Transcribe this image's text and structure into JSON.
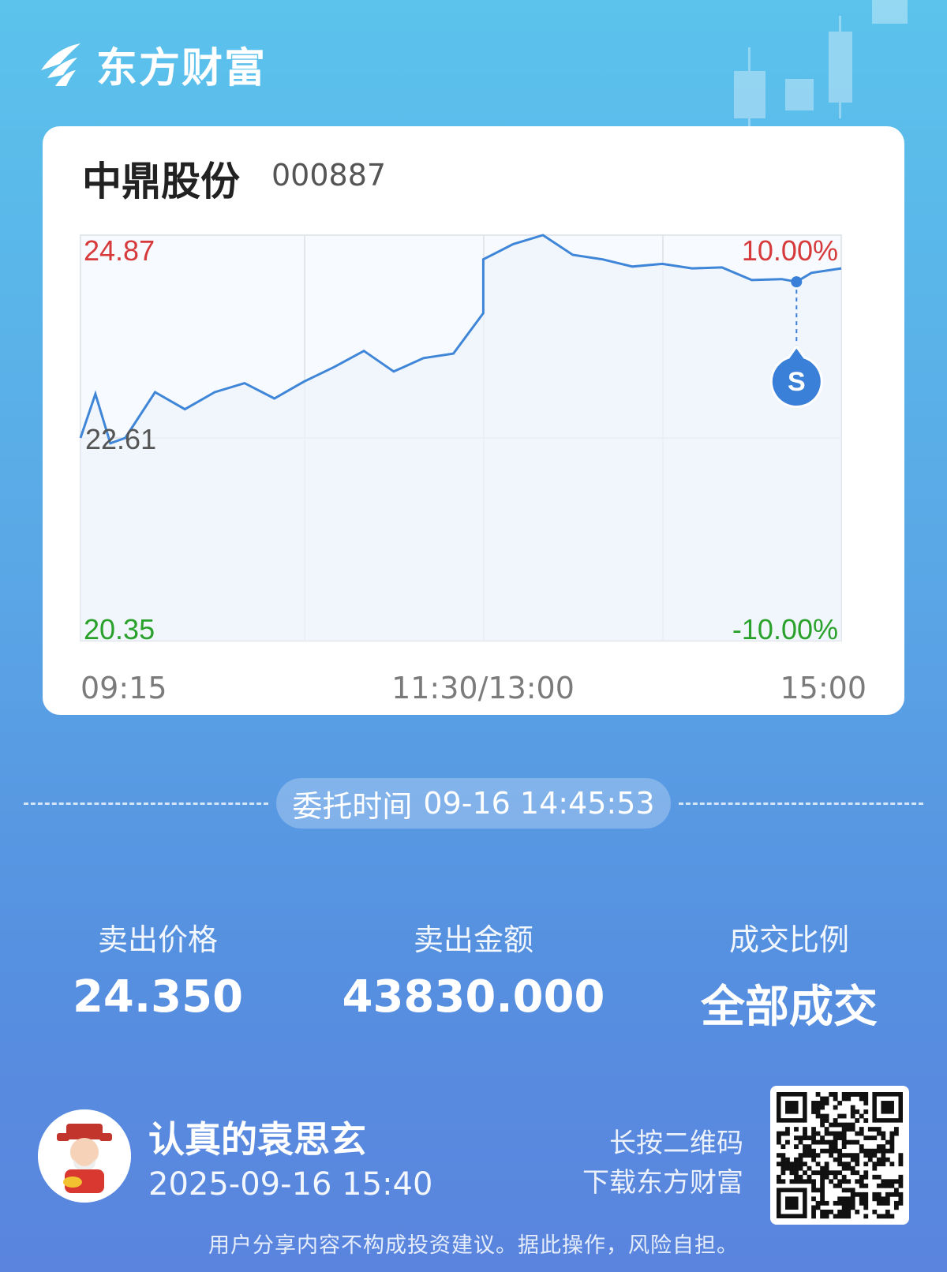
{
  "brand": {
    "name": "东方财富",
    "logo_icon": "eastmoney-logo-icon"
  },
  "stock": {
    "name": "中鼎股份",
    "code": "000887"
  },
  "chart_data": {
    "type": "line",
    "title": "",
    "x_ticks": [
      "09:15",
      "11:30/13:00",
      "15:00"
    ],
    "price_labels": {
      "high": "24.87",
      "prev_close": "22.61",
      "low": "20.35"
    },
    "pct_labels": {
      "high": "10.00%",
      "low": "-10.00%"
    },
    "ylim": [
      20.35,
      24.87
    ],
    "grid": true,
    "series": [
      {
        "x": [
          "09:15",
          "09:20",
          "09:25",
          "09:30",
          "09:40",
          "09:50",
          "10:00",
          "10:10",
          "10:20",
          "10:30",
          "10:40",
          "10:50",
          "11:00",
          "11:10",
          "11:20",
          "11:30",
          "13:00",
          "13:10",
          "13:20",
          "13:30",
          "13:40",
          "13:50",
          "14:00",
          "14:10",
          "14:20",
          "14:30",
          "14:40",
          "14:45",
          "14:50",
          "15:00"
        ],
        "values": [
          22.61,
          23.1,
          22.55,
          22.61,
          23.12,
          22.93,
          23.12,
          23.22,
          23.05,
          23.24,
          23.4,
          23.58,
          23.35,
          23.5,
          23.55,
          24.0,
          24.6,
          24.77,
          24.87,
          24.65,
          24.6,
          24.52,
          24.55,
          24.5,
          24.51,
          24.37,
          24.38,
          24.35,
          24.45,
          24.5
        ]
      }
    ],
    "marker": {
      "label": "S",
      "x": "14:45",
      "value": 24.35
    }
  },
  "order": {
    "label": "委托时间",
    "value": "09-16 14:45:53"
  },
  "stats": [
    {
      "label": "卖出价格",
      "value": "24.350"
    },
    {
      "label": "卖出金额",
      "value": "43830.000"
    },
    {
      "label": "成交比例",
      "value": "全部成交"
    }
  ],
  "user": {
    "name": "认真的袁思玄",
    "time": "2025-09-16 15:40",
    "avatar_icon": "caishen-avatar-icon"
  },
  "qr": {
    "hint_line1": "长按二维码",
    "hint_line2": "下载东方财富",
    "icon": "qr-code-icon"
  },
  "disclaimer": "用户分享内容不构成投资建议。据此操作，风险自担。",
  "colors": {
    "line": "#3f86d8",
    "up": "#d63a3a",
    "down": "#2aa12a",
    "marker": "#3a7fd8"
  }
}
